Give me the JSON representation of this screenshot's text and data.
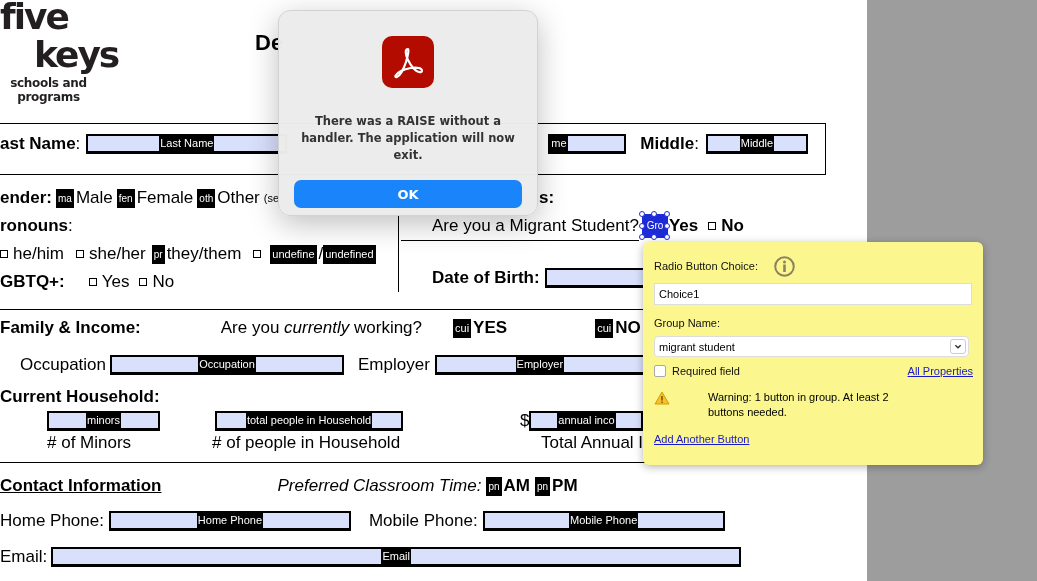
{
  "logo": {
    "line1": "five",
    "line2": "keys",
    "tagline": [
      "schools and",
      "programs"
    ]
  },
  "document_title": "De",
  "name_row": {
    "last_label": "**ast Name**:",
    "last_field": "Last Name",
    "first_field": "me",
    "middle_label": "**Middle**:",
    "middle_field": "Middle"
  },
  "gender": {
    "label": "ender:",
    "options": [
      {
        "tag": "ma",
        "label": "Male"
      },
      {
        "tag": "fen",
        "label": "Female"
      },
      {
        "tag": "oth",
        "label": "Other"
      }
    ],
    "note": "(se"
  },
  "status_label": "s:",
  "migrant": {
    "question": "Are you a Migrant Student?",
    "selected_field": "Gro",
    "yes": "Yes",
    "no": "No"
  },
  "pronouns": {
    "label": "**ronouns**:",
    "options": [
      {
        "kind": "checkbox",
        "label": "he/him"
      },
      {
        "kind": "checkbox",
        "label": "she/her"
      },
      {
        "kind": "tag",
        "tag": "pr",
        "label": "they/them"
      },
      {
        "kind": "custom",
        "tags": [
          "undefine",
          "undefined"
        ],
        "separator": "/"
      }
    ]
  },
  "lgbtq": {
    "label": "GBTQ+:",
    "options": [
      "Yes",
      "No"
    ]
  },
  "dob_label": "Date of Birth:",
  "family": {
    "label": "Family & Income:",
    "question": "Are you *currently* working?",
    "options": [
      {
        "tag": "cui",
        "label": "YES"
      },
      {
        "tag": "cui",
        "label": "NO"
      }
    ]
  },
  "occupation": {
    "label": "Occupation",
    "field": "Occupation",
    "employer_label": "Employer",
    "employer_field": "Employer"
  },
  "household": {
    "label": "Current Household:",
    "fields": [
      {
        "field": "minors",
        "caption": "# of Minors"
      },
      {
        "field": "total people in Household",
        "caption": "# of people in Household"
      },
      {
        "prefix": "$",
        "field": "annual inco",
        "caption": "Total Annual I"
      }
    ]
  },
  "contact": {
    "label": "Contact Information",
    "time_label": "Preferred Classroom Time:",
    "times": [
      {
        "tag": "pn",
        "label": "AM"
      },
      {
        "tag": "pn",
        "label": "PM"
      }
    ],
    "home_label": "Home Phone:",
    "home_field": "Home Phone",
    "mobile_label": "Mobile Phone:",
    "mobile_field": "Mobile Phone",
    "email_label": "Email:",
    "email_field": "Email"
  },
  "alert": {
    "message": "There was a RAISE without a handler. The application will now exit.",
    "button": "OK"
  },
  "popup": {
    "choice_label": "Radio Button Choice:",
    "choice_value": "Choice1",
    "group_label": "Group Name:",
    "group_value": "migrant student",
    "required": {
      "label": "Required field",
      "checked": false
    },
    "properties_link": "All Properties",
    "warning": "Warning: 1 button in group. At least 2 buttons needed.",
    "add_link": "Add Another Button"
  }
}
